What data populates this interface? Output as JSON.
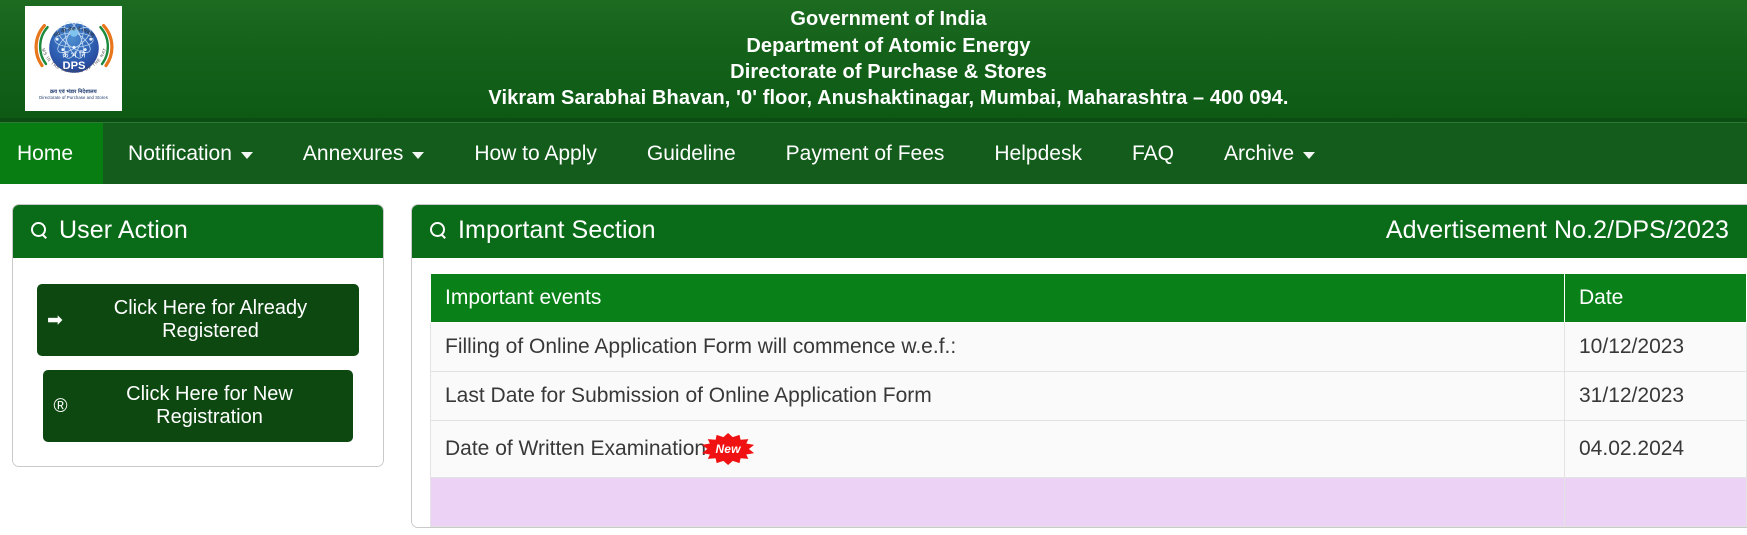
{
  "header": {
    "logo": {
      "icon": "dps-dae-emblem-logo",
      "acronym": "DPS",
      "devanagari_motto": "क्रं भं नि",
      "arc_top_text": "राष्ट्र की सेवा में परमाणु",
      "arc_bottom_text": "ATOMS IN THE SERVICE OF THE NATION",
      "caption_hindi": "क्रय एवं भंडार निदेशालय",
      "caption_english": "Directorate of Purchase and Stores"
    },
    "lines": [
      "Government of India",
      "Department of Atomic Energy",
      "Directorate of Purchase & Stores",
      "Vikram Sarabhai Bhavan, '0' floor, Anushaktinagar, Mumbai, Maharashtra – 400 094."
    ]
  },
  "nav": {
    "items": [
      {
        "label": "Home",
        "has_caret": false,
        "active": true
      },
      {
        "label": "Notification",
        "has_caret": true,
        "active": false
      },
      {
        "label": "Annexures",
        "has_caret": true,
        "active": false
      },
      {
        "label": "How to Apply",
        "has_caret": false,
        "active": false
      },
      {
        "label": "Guideline",
        "has_caret": false,
        "active": false
      },
      {
        "label": "Payment of Fees",
        "has_caret": false,
        "active": false
      },
      {
        "label": "Helpdesk",
        "has_caret": false,
        "active": false
      },
      {
        "label": "FAQ",
        "has_caret": false,
        "active": false
      },
      {
        "label": "Archive",
        "has_caret": true,
        "active": false
      }
    ]
  },
  "user_action_panel": {
    "icon": "search-icon",
    "title": "User Action",
    "buttons": [
      {
        "icon": "sign-in-icon",
        "glyph": "➡",
        "label": "Click Here for Already Registered"
      },
      {
        "icon": "registered-icon",
        "glyph": "®",
        "label": "Click Here for New Registration"
      }
    ]
  },
  "important_section_panel": {
    "icon": "search-icon",
    "title": "Important Section",
    "advertisement_no": "Advertisement No.2/DPS/2023",
    "table": {
      "columns": [
        "Important events",
        "Date"
      ],
      "rows": [
        {
          "event": "Filling of Online Application Form will commence w.e.f.:",
          "date": "10/12/2023",
          "badge": null,
          "highlight": false
        },
        {
          "event": "Last Date for Submission of Online Application Form",
          "date": "31/12/2023",
          "badge": null,
          "highlight": false
        },
        {
          "event": "Date of Written Examination",
          "date": "04.02.2024",
          "badge": "New",
          "highlight": false
        },
        {
          "event": "",
          "date": "",
          "badge": null,
          "highlight": true
        }
      ]
    }
  },
  "colors": {
    "header_green": "#14621a",
    "nav_green": "#145c1c",
    "nav_active_green": "#087d12",
    "panel_head_green": "#0a6b18",
    "table_head_green": "#0a8018",
    "button_dark_green": "#0d4811",
    "badge_red": "#f01212",
    "highlight_lavender": "#ecd2f5"
  }
}
